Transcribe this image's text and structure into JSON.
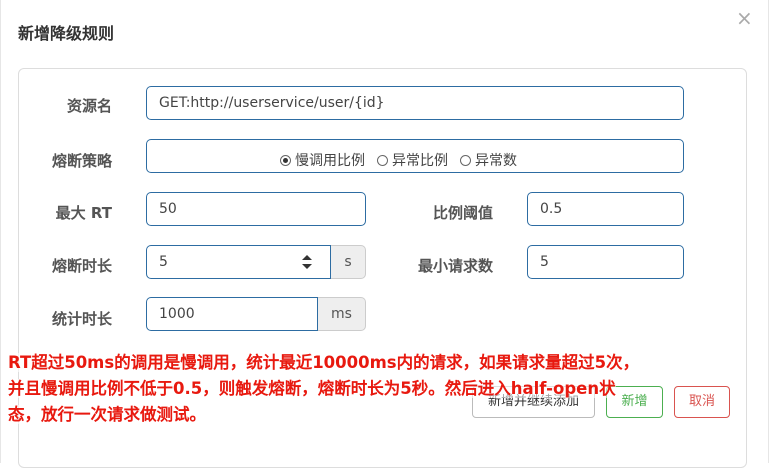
{
  "dialog": {
    "title": "新增降级规则",
    "close_label": "×"
  },
  "form": {
    "resource": {
      "label": "资源名",
      "value": "GET:http://userservice/user/{id}"
    },
    "strategy": {
      "label": "熔断策略",
      "options": [
        "慢调用比例",
        "异常比例",
        "异常数"
      ],
      "selected": "慢调用比例"
    },
    "max_rt": {
      "label": "最大 RT",
      "value": "50"
    },
    "ratio": {
      "label": "比例阈值",
      "value": "0.5"
    },
    "break_duration": {
      "label": "熔断时长",
      "value": "5",
      "unit": "s"
    },
    "min_requests": {
      "label": "最小请求数",
      "value": "5"
    },
    "stat_duration": {
      "label": "统计时长",
      "value": "1000",
      "unit": "ms"
    }
  },
  "buttons": {
    "add_continue": "新增并继续添加",
    "add": "新增",
    "cancel": "取消"
  },
  "annotation": {
    "line1": "RT超过50ms的调用是慢调用，统计最近10000ms内的请求，如果请求量超过5次，",
    "line2": "并且慢调用比例不低于0.5，则触发熔断，熔断时长为5秒。然后进入half-open状",
    "line3": "态，放行一次请求做测试。"
  },
  "colors": {
    "input_border": "#2d6ca2",
    "add_button": "#4caf50",
    "cancel_button": "#d9534f",
    "annotation_text": "#e8190f"
  }
}
